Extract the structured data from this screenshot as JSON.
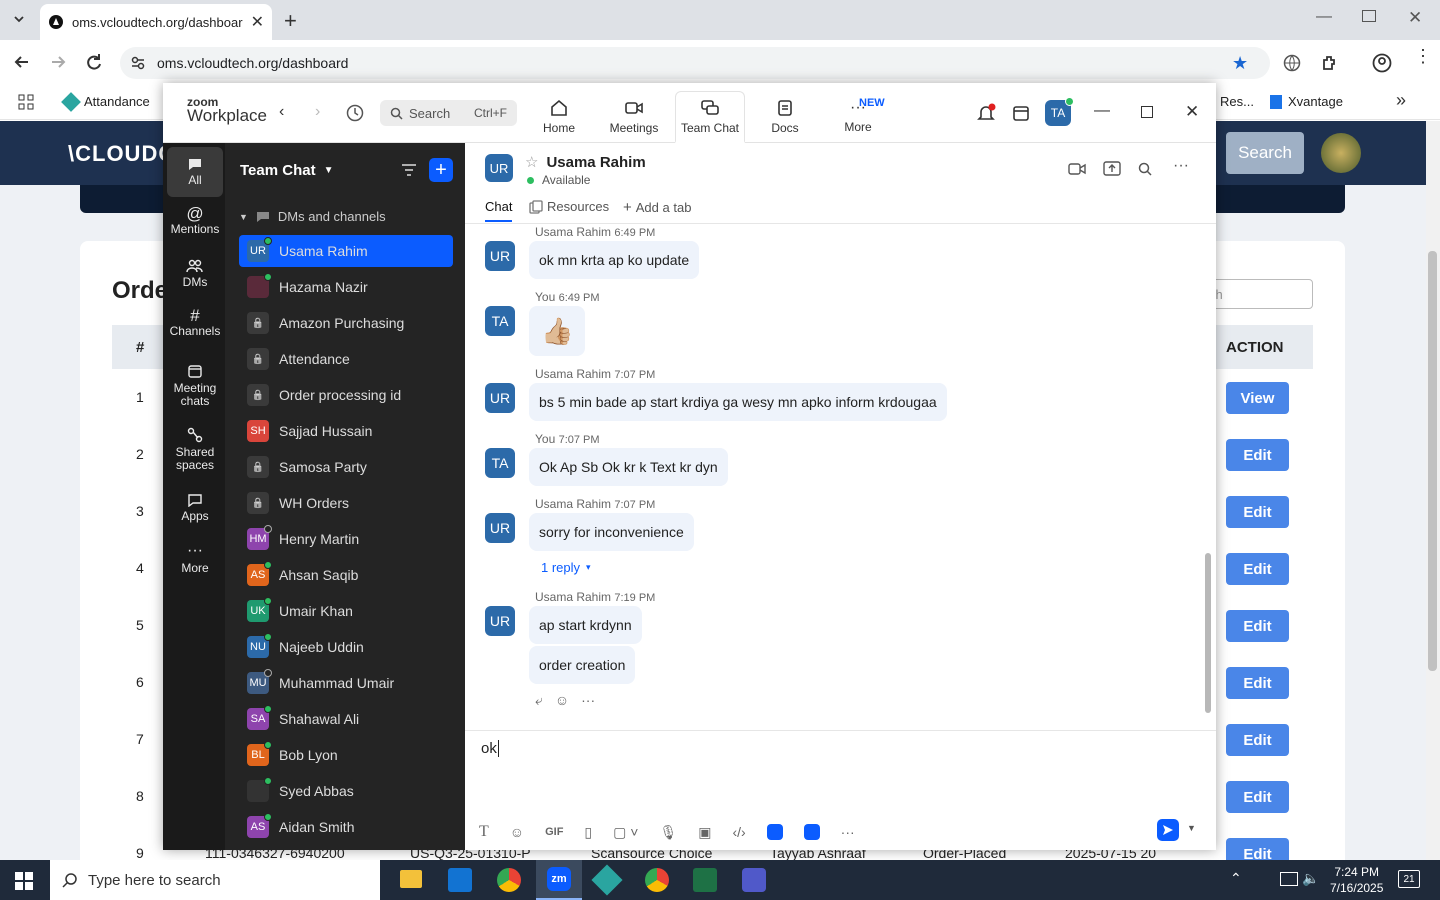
{
  "browser": {
    "tab_title": "oms.vcloudtech.org/dashboard",
    "url": "oms.vcloudtech.org/dashboard",
    "bookmarks": [
      "Attandance",
      "Res...",
      "Xvantage"
    ]
  },
  "web": {
    "logo": "\\CLOUDC",
    "search_button": "Search",
    "search_placeholder": "ch",
    "page_title": "Orde",
    "col_hash": "#",
    "col_action": "ACTION",
    "row_numbers": [
      "1",
      "2",
      "3",
      "4",
      "5",
      "6",
      "7",
      "8",
      "9"
    ],
    "view_label": "View",
    "edit_label": "Edit",
    "bottom_row": {
      "order": "111-0346327-6940200",
      "code": "US-Q3-25-01310-P",
      "source": "Scansource Choice",
      "person": "Tayyab Ashraaf",
      "status": "Order-Placed",
      "date": "2025-07-15 20"
    }
  },
  "zoom": {
    "logo_small": "zoom",
    "logo_big": "Workplace",
    "search_label": "Search",
    "search_shortcut": "Ctrl+F",
    "nav": [
      "Home",
      "Meetings",
      "Team Chat",
      "Docs",
      "More"
    ],
    "new_badge": "NEW",
    "profile_initials": "TA",
    "rail": [
      "All",
      "Mentions",
      "DMs",
      "Channels",
      "Meeting chats",
      "Shared spaces",
      "Apps",
      "More"
    ],
    "list_header": "Team Chat",
    "section": "DMs and channels",
    "contacts": [
      {
        "name": "Usama Rahim",
        "initials": "UR",
        "color": "#2c6aa9",
        "status": "online",
        "active": true
      },
      {
        "name": "Hazama Nazir",
        "initials": "",
        "color": "#5a2a3a",
        "status": "online"
      },
      {
        "name": "Amazon Purchasing",
        "initials": "",
        "color": "",
        "status": "lock"
      },
      {
        "name": "Attendance",
        "initials": "",
        "color": "",
        "status": "lock"
      },
      {
        "name": "Order processing id",
        "initials": "",
        "color": "",
        "status": "lock"
      },
      {
        "name": "Sajjad Hussain",
        "initials": "SH",
        "color": "#d9453b",
        "status": "none"
      },
      {
        "name": "Samosa Party",
        "initials": "",
        "color": "",
        "status": "lock"
      },
      {
        "name": "WH Orders",
        "initials": "",
        "color": "",
        "status": "lock"
      },
      {
        "name": "Henry Martin",
        "initials": "HM",
        "color": "#8e44ad",
        "status": "offline"
      },
      {
        "name": "Ahsan Saqib",
        "initials": "AS",
        "color": "#e0651c",
        "status": "online"
      },
      {
        "name": "Umair Khan",
        "initials": "UK",
        "color": "#1f9a6f",
        "status": "online"
      },
      {
        "name": "Najeeb Uddin",
        "initials": "NU",
        "color": "#2c6aa9",
        "status": "online"
      },
      {
        "name": "Muhammad Umair",
        "initials": "MU",
        "color": "#3d5a80",
        "status": "offline"
      },
      {
        "name": "Shahawal Ali",
        "initials": "SA",
        "color": "#8e44ad",
        "status": "online"
      },
      {
        "name": "Bob Lyon",
        "initials": "BL",
        "color": "#e0651c",
        "status": "online"
      },
      {
        "name": "Syed Abbas",
        "initials": "",
        "color": "#333333",
        "status": "online"
      },
      {
        "name": "Aidan Smith",
        "initials": "AS",
        "color": "#8e44ad",
        "status": "online"
      }
    ],
    "chat": {
      "contact_name": "Usama Rahim",
      "contact_initials": "UR",
      "contact_status": "Available",
      "tabs": [
        "Chat",
        "Resources",
        "Add a tab"
      ],
      "messages": [
        {
          "sender": "Usama Rahim",
          "time": "6:49 PM",
          "avatar": "UR",
          "text": "ok mn krta ap ko update"
        },
        {
          "sender": "You",
          "time": "6:49 PM",
          "avatar": "TA",
          "text": "👍🏼"
        },
        {
          "sender": "Usama Rahim",
          "time": "7:07 PM",
          "avatar": "UR",
          "text": "bs 5 min bade ap start krdiya ga wesy mn apko inform krdougaa"
        },
        {
          "sender": "You",
          "time": "7:07 PM",
          "avatar": "TA",
          "text": "Ok Ap Sb Ok kr k Text kr dyn"
        },
        {
          "sender": "Usama Rahim",
          "time": "7:07 PM",
          "avatar": "UR",
          "text": "sorry for inconvenience"
        },
        {
          "sender": "Usama Rahim",
          "time": "7:19 PM",
          "avatar": "UR",
          "text": "ap start krdynn"
        },
        {
          "sender": "",
          "time": "",
          "avatar": "",
          "text": "order creation"
        }
      ],
      "reply_link": "1 reply",
      "composer_value": "ok"
    }
  },
  "taskbar": {
    "search_placeholder": "Type here to search",
    "time": "7:24 PM",
    "date": "7/16/2025",
    "notifications": "21"
  }
}
